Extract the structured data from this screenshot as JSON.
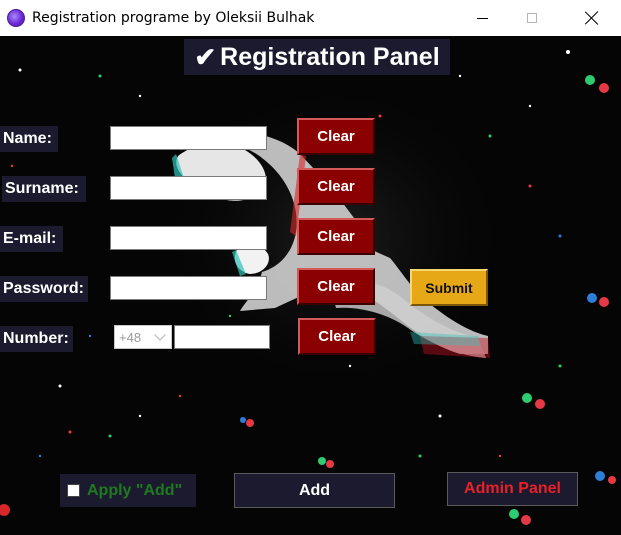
{
  "window": {
    "title": "Registration programe by Oleksii Bulhak",
    "controls": [
      "minimize",
      "maximize",
      "close"
    ]
  },
  "panel": {
    "check_icon": "✔",
    "title": "Registration Panel"
  },
  "fields": [
    {
      "label": "Name:",
      "value": "",
      "clear_label": "Clear"
    },
    {
      "label": "Surname:",
      "value": "",
      "clear_label": "Clear"
    },
    {
      "label": "E-mail:",
      "value": "",
      "clear_label": "Clear"
    },
    {
      "label": "Password:",
      "value": "",
      "clear_label": "Clear"
    },
    {
      "label": "Number:",
      "prefix": "+48",
      "value": "",
      "clear_label": "Clear"
    }
  ],
  "submit_label": "Submit",
  "apply_add": {
    "label": "Apply \"Add\"",
    "checked": false
  },
  "add_label": "Add",
  "admin_label": "Admin Panel",
  "colors": {
    "clear_button": "#8b0000",
    "submit_button": "#e6a817",
    "label_bg": "#1c1a2e",
    "apply_text": "#1f7a1f",
    "admin_text": "#e8202a"
  },
  "icons": {
    "app": "app-icon",
    "dropdown": "chevron-down-icon",
    "checkbox": "checkbox-icon"
  }
}
